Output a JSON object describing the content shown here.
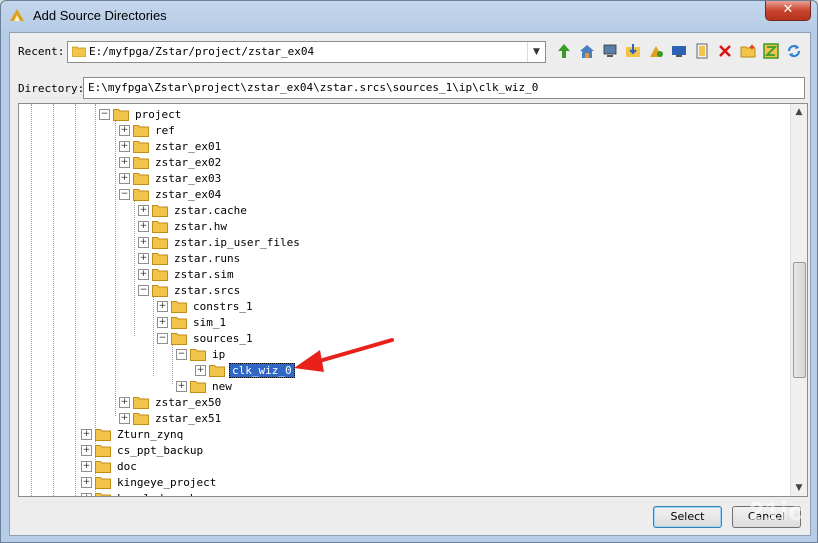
{
  "window": {
    "title": "Add Source Directories",
    "close_glyph": "✕"
  },
  "recent": {
    "label": "Recent:",
    "value": "E:/myfpga/Zstar/project/zstar_ex04"
  },
  "toolbar_icons": [
    "go-up-icon",
    "home-icon",
    "computer-icon",
    "download-folder-icon",
    "refresh-tree-icon",
    "desktop-icon",
    "file-list-icon",
    "delete-icon",
    "new-folder-icon",
    "collapse-icon",
    "sync-icon"
  ],
  "directory": {
    "label": "Directory:",
    "value": "E:\\myfpga\\Zstar\\project\\zstar_ex04\\zstar.srcs\\sources_1\\ip\\clk_wiz_0"
  },
  "tree": [
    {
      "label": "project",
      "exp": "−"
    },
    {
      "label": "ref",
      "exp": "+"
    },
    {
      "label": "zstar_ex01",
      "exp": "+"
    },
    {
      "label": "zstar_ex02",
      "exp": "+"
    },
    {
      "label": "zstar_ex03",
      "exp": "+"
    },
    {
      "label": "zstar_ex04",
      "exp": "−"
    },
    {
      "label": "zstar.cache",
      "exp": "+"
    },
    {
      "label": "zstar.hw",
      "exp": "+"
    },
    {
      "label": "zstar.ip_user_files",
      "exp": "+"
    },
    {
      "label": "zstar.runs",
      "exp": "+"
    },
    {
      "label": "zstar.sim",
      "exp": "+"
    },
    {
      "label": "zstar.srcs",
      "exp": "−"
    },
    {
      "label": "constrs_1",
      "exp": "+"
    },
    {
      "label": "sim_1",
      "exp": "+"
    },
    {
      "label": "sources_1",
      "exp": "−"
    },
    {
      "label": "ip",
      "exp": "−"
    },
    {
      "label": "clk_wiz_0",
      "exp": "+",
      "selected": true
    },
    {
      "label": "new",
      "exp": "+"
    },
    {
      "label": "zstar_ex50",
      "exp": "+"
    },
    {
      "label": "zstar_ex51",
      "exp": "+"
    },
    {
      "label": "Zturn_zynq",
      "exp": "+"
    },
    {
      "label": "cs_ppt_backup",
      "exp": "+"
    },
    {
      "label": "doc",
      "exp": "+"
    },
    {
      "label": "kingeye_project",
      "exp": "+"
    },
    {
      "label": "knowledge_share",
      "exp": "+"
    }
  ],
  "buttons": {
    "select": "Select",
    "cancel": "Cancel"
  },
  "colors": {
    "selection": "#3167c4",
    "arrow": "#e8221b",
    "folder": "#f2c44a"
  },
  "watermark": "21ic"
}
